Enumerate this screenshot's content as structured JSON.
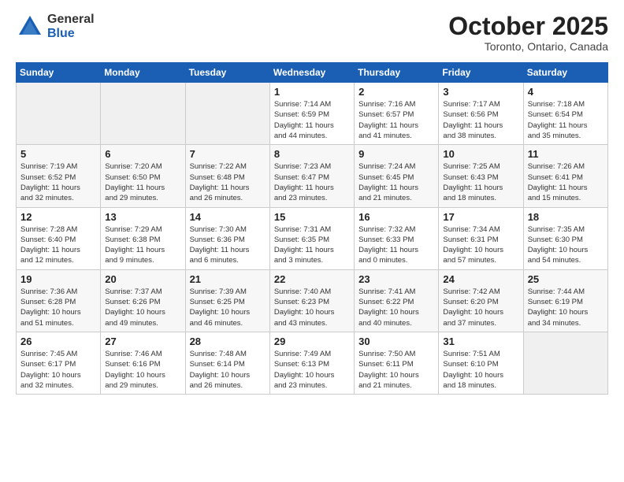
{
  "header": {
    "logo_general": "General",
    "logo_blue": "Blue",
    "month_title": "October 2025",
    "location": "Toronto, Ontario, Canada"
  },
  "weekdays": [
    "Sunday",
    "Monday",
    "Tuesday",
    "Wednesday",
    "Thursday",
    "Friday",
    "Saturday"
  ],
  "weeks": [
    [
      {
        "day": "",
        "info": ""
      },
      {
        "day": "",
        "info": ""
      },
      {
        "day": "",
        "info": ""
      },
      {
        "day": "1",
        "info": "Sunrise: 7:14 AM\nSunset: 6:59 PM\nDaylight: 11 hours\nand 44 minutes."
      },
      {
        "day": "2",
        "info": "Sunrise: 7:16 AM\nSunset: 6:57 PM\nDaylight: 11 hours\nand 41 minutes."
      },
      {
        "day": "3",
        "info": "Sunrise: 7:17 AM\nSunset: 6:56 PM\nDaylight: 11 hours\nand 38 minutes."
      },
      {
        "day": "4",
        "info": "Sunrise: 7:18 AM\nSunset: 6:54 PM\nDaylight: 11 hours\nand 35 minutes."
      }
    ],
    [
      {
        "day": "5",
        "info": "Sunrise: 7:19 AM\nSunset: 6:52 PM\nDaylight: 11 hours\nand 32 minutes."
      },
      {
        "day": "6",
        "info": "Sunrise: 7:20 AM\nSunset: 6:50 PM\nDaylight: 11 hours\nand 29 minutes."
      },
      {
        "day": "7",
        "info": "Sunrise: 7:22 AM\nSunset: 6:48 PM\nDaylight: 11 hours\nand 26 minutes."
      },
      {
        "day": "8",
        "info": "Sunrise: 7:23 AM\nSunset: 6:47 PM\nDaylight: 11 hours\nand 23 minutes."
      },
      {
        "day": "9",
        "info": "Sunrise: 7:24 AM\nSunset: 6:45 PM\nDaylight: 11 hours\nand 21 minutes."
      },
      {
        "day": "10",
        "info": "Sunrise: 7:25 AM\nSunset: 6:43 PM\nDaylight: 11 hours\nand 18 minutes."
      },
      {
        "day": "11",
        "info": "Sunrise: 7:26 AM\nSunset: 6:41 PM\nDaylight: 11 hours\nand 15 minutes."
      }
    ],
    [
      {
        "day": "12",
        "info": "Sunrise: 7:28 AM\nSunset: 6:40 PM\nDaylight: 11 hours\nand 12 minutes."
      },
      {
        "day": "13",
        "info": "Sunrise: 7:29 AM\nSunset: 6:38 PM\nDaylight: 11 hours\nand 9 minutes."
      },
      {
        "day": "14",
        "info": "Sunrise: 7:30 AM\nSunset: 6:36 PM\nDaylight: 11 hours\nand 6 minutes."
      },
      {
        "day": "15",
        "info": "Sunrise: 7:31 AM\nSunset: 6:35 PM\nDaylight: 11 hours\nand 3 minutes."
      },
      {
        "day": "16",
        "info": "Sunrise: 7:32 AM\nSunset: 6:33 PM\nDaylight: 11 hours\nand 0 minutes."
      },
      {
        "day": "17",
        "info": "Sunrise: 7:34 AM\nSunset: 6:31 PM\nDaylight: 10 hours\nand 57 minutes."
      },
      {
        "day": "18",
        "info": "Sunrise: 7:35 AM\nSunset: 6:30 PM\nDaylight: 10 hours\nand 54 minutes."
      }
    ],
    [
      {
        "day": "19",
        "info": "Sunrise: 7:36 AM\nSunset: 6:28 PM\nDaylight: 10 hours\nand 51 minutes."
      },
      {
        "day": "20",
        "info": "Sunrise: 7:37 AM\nSunset: 6:26 PM\nDaylight: 10 hours\nand 49 minutes."
      },
      {
        "day": "21",
        "info": "Sunrise: 7:39 AM\nSunset: 6:25 PM\nDaylight: 10 hours\nand 46 minutes."
      },
      {
        "day": "22",
        "info": "Sunrise: 7:40 AM\nSunset: 6:23 PM\nDaylight: 10 hours\nand 43 minutes."
      },
      {
        "day": "23",
        "info": "Sunrise: 7:41 AM\nSunset: 6:22 PM\nDaylight: 10 hours\nand 40 minutes."
      },
      {
        "day": "24",
        "info": "Sunrise: 7:42 AM\nSunset: 6:20 PM\nDaylight: 10 hours\nand 37 minutes."
      },
      {
        "day": "25",
        "info": "Sunrise: 7:44 AM\nSunset: 6:19 PM\nDaylight: 10 hours\nand 34 minutes."
      }
    ],
    [
      {
        "day": "26",
        "info": "Sunrise: 7:45 AM\nSunset: 6:17 PM\nDaylight: 10 hours\nand 32 minutes."
      },
      {
        "day": "27",
        "info": "Sunrise: 7:46 AM\nSunset: 6:16 PM\nDaylight: 10 hours\nand 29 minutes."
      },
      {
        "day": "28",
        "info": "Sunrise: 7:48 AM\nSunset: 6:14 PM\nDaylight: 10 hours\nand 26 minutes."
      },
      {
        "day": "29",
        "info": "Sunrise: 7:49 AM\nSunset: 6:13 PM\nDaylight: 10 hours\nand 23 minutes."
      },
      {
        "day": "30",
        "info": "Sunrise: 7:50 AM\nSunset: 6:11 PM\nDaylight: 10 hours\nand 21 minutes."
      },
      {
        "day": "31",
        "info": "Sunrise: 7:51 AM\nSunset: 6:10 PM\nDaylight: 10 hours\nand 18 minutes."
      },
      {
        "day": "",
        "info": ""
      }
    ]
  ]
}
